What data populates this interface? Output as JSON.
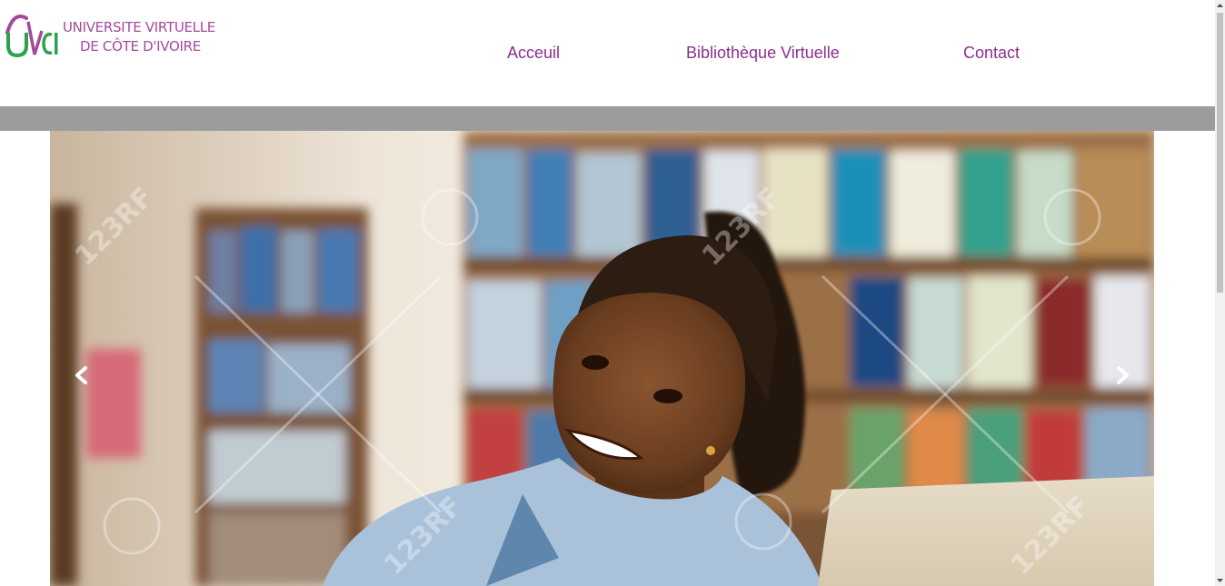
{
  "logo": {
    "mark": "UVCI",
    "line1": "UNIVERSITE VIRTUELLE",
    "line2": "DE CÔTE D'IVOIRE"
  },
  "nav": {
    "home": "Acceuil",
    "library": "Bibliothèque Virtuelle",
    "contact": "Contact"
  },
  "carousel": {
    "image": "smiling student with bookshelves",
    "watermark": "123RF"
  },
  "colors": {
    "brand_purple": "#8c2f8c",
    "brand_green": "#2aa34a",
    "band_grey": "#9b9c9d"
  },
  "icons": [
    "chevron-left-icon",
    "chevron-right-icon",
    "scroll-up-icon",
    "scroll-down-icon"
  ]
}
